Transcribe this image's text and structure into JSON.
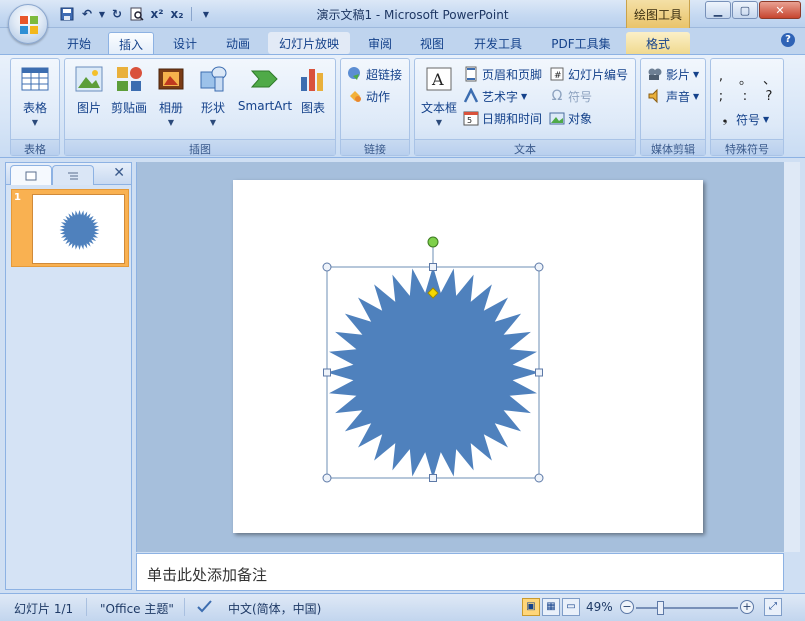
{
  "window": {
    "title": "演示文稿1 - Microsoft PowerPoint",
    "context_tool": "绘图工具"
  },
  "qat": {
    "items": [
      "save-icon",
      "undo-icon",
      "redo-icon",
      "print-preview-icon",
      "superscript-icon",
      "subscript-icon"
    ],
    "superscript": "x²",
    "subscript": "x₂"
  },
  "tabs": [
    "开始",
    "插入",
    "设计",
    "动画",
    "幻灯片放映",
    "审阅",
    "视图",
    "开发工具",
    "PDF工具集",
    "格式"
  ],
  "ribbon": {
    "groups": {
      "table": {
        "label": "表格",
        "btn": "表格"
      },
      "illustrations": {
        "label": "插图",
        "picture": "图片",
        "clipart": "剪贴画",
        "album": "相册",
        "shapes": "形状",
        "smartart": "SmartArt",
        "chart": "图表"
      },
      "links": {
        "label": "链接",
        "hyperlink": "超链接",
        "action": "动作"
      },
      "text": {
        "label": "文本",
        "textbox": "文本框",
        "header_footer": "页眉和页脚",
        "wordart": "艺术字",
        "datetime": "日期和时间",
        "slide_number": "幻灯片编号",
        "symbol": "符号",
        "object": "对象"
      },
      "media": {
        "label": "媒体剪辑",
        "movie": "影片",
        "sound": "声音"
      },
      "special": {
        "label": "特殊符号",
        "symbol_btn": "符号",
        "chars": [
          ",",
          "。",
          "、",
          ";",
          ":",
          "?"
        ]
      }
    }
  },
  "pane": {
    "slide_number": "1"
  },
  "notes": {
    "placeholder": "单击此处添加备注"
  },
  "status": {
    "slide": "幻灯片 1/1",
    "theme": "\"Office 主题\"",
    "language": "中文(简体，中国)",
    "zoom": "49%"
  },
  "colors": {
    "shape_fill": "#4f81bd",
    "handle_green": "#7ed04b",
    "handle_yellow": "#f5d800"
  }
}
